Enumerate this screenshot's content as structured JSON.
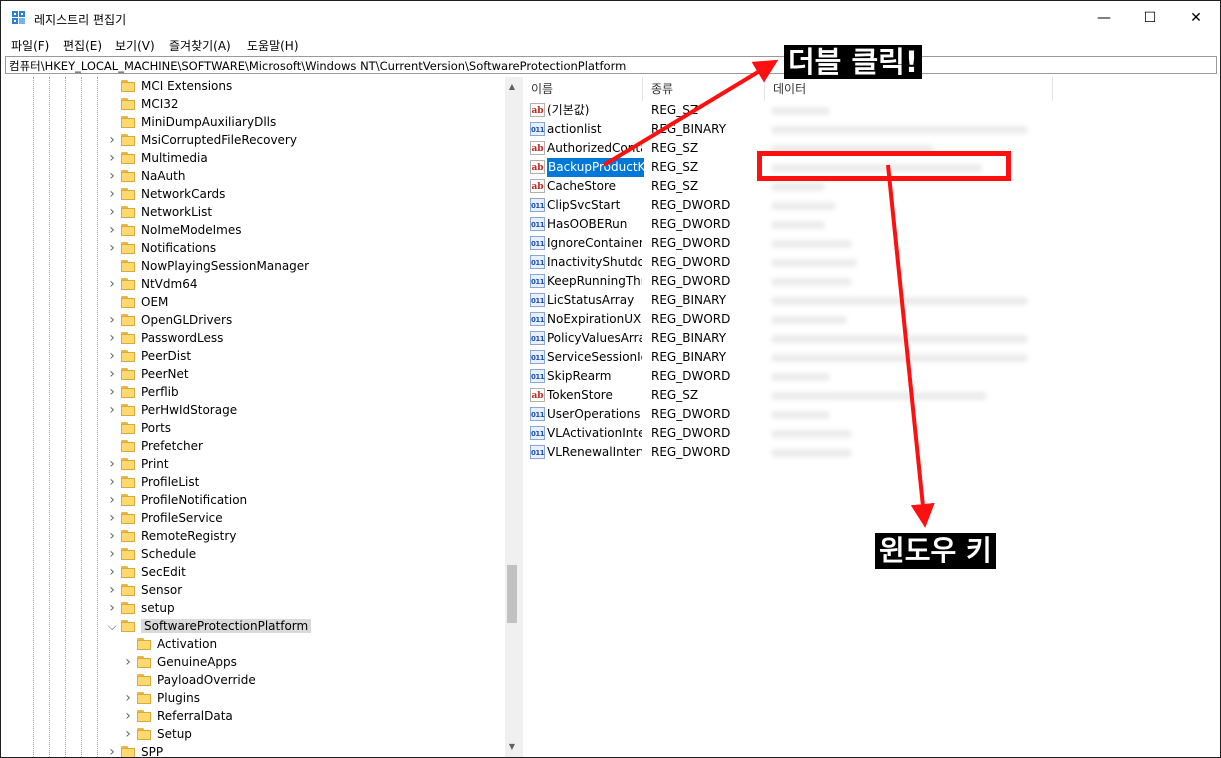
{
  "window": {
    "title": "레지스트리 편집기",
    "min_glyph": "—",
    "max_glyph": "☐",
    "close_glyph": "✕"
  },
  "menu": [
    "파일(F)",
    "편집(E)",
    "보기(V)",
    "즐겨찾기(A)",
    "도움말(H)"
  ],
  "address": "컴퓨터\\HKEY_LOCAL_MACHINE\\SOFTWARE\\Microsoft\\Windows NT\\CurrentVersion\\SoftwareProtectionPlatform",
  "tree": {
    "nodes": [
      {
        "label": "MCI Extensions",
        "expandable": false
      },
      {
        "label": "MCI32",
        "expandable": false
      },
      {
        "label": "MiniDumpAuxiliaryDlls",
        "expandable": false
      },
      {
        "label": "MsiCorruptedFileRecovery",
        "expandable": true
      },
      {
        "label": "Multimedia",
        "expandable": true
      },
      {
        "label": "NaAuth",
        "expandable": true
      },
      {
        "label": "NetworkCards",
        "expandable": true
      },
      {
        "label": "NetworkList",
        "expandable": true
      },
      {
        "label": "NoImeModeImes",
        "expandable": true
      },
      {
        "label": "Notifications",
        "expandable": true
      },
      {
        "label": "NowPlayingSessionManager",
        "expandable": false
      },
      {
        "label": "NtVdm64",
        "expandable": true
      },
      {
        "label": "OEM",
        "expandable": false
      },
      {
        "label": "OpenGLDrivers",
        "expandable": true
      },
      {
        "label": "PasswordLess",
        "expandable": true
      },
      {
        "label": "PeerDist",
        "expandable": true
      },
      {
        "label": "PeerNet",
        "expandable": true
      },
      {
        "label": "Perflib",
        "expandable": true
      },
      {
        "label": "PerHwIdStorage",
        "expandable": true
      },
      {
        "label": "Ports",
        "expandable": false
      },
      {
        "label": "Prefetcher",
        "expandable": false
      },
      {
        "label": "Print",
        "expandable": true
      },
      {
        "label": "ProfileList",
        "expandable": true
      },
      {
        "label": "ProfileNotification",
        "expandable": true
      },
      {
        "label": "ProfileService",
        "expandable": true
      },
      {
        "label": "RemoteRegistry",
        "expandable": true
      },
      {
        "label": "Schedule",
        "expandable": true
      },
      {
        "label": "SecEdit",
        "expandable": true
      },
      {
        "label": "Sensor",
        "expandable": true
      },
      {
        "label": "setup",
        "expandable": true
      },
      {
        "label": "SoftwareProtectionPlatform",
        "expandable": true,
        "expanded": true,
        "selected": true
      },
      {
        "label": "Activation",
        "expandable": false,
        "child": true
      },
      {
        "label": "GenuineApps",
        "expandable": true,
        "child": true
      },
      {
        "label": "PayloadOverride",
        "expandable": false,
        "child": true
      },
      {
        "label": "Plugins",
        "expandable": true,
        "child": true
      },
      {
        "label": "ReferralData",
        "expandable": true,
        "child": true
      },
      {
        "label": "Setup",
        "expandable": true,
        "child": true
      },
      {
        "label": "SPP",
        "expandable": true
      }
    ]
  },
  "values_pane": {
    "headers": {
      "name": "이름",
      "type": "종류",
      "data": "데이터"
    },
    "icon_glyphs": {
      "sz": "ab",
      "bin": "011"
    },
    "rows": [
      {
        "name": "(기본값)",
        "type": "REG_SZ",
        "icon": "sz",
        "data_fill": 0.22
      },
      {
        "name": "actionlist",
        "type": "REG_BINARY",
        "icon": "bin",
        "data_fill": 0.95
      },
      {
        "name": "AuthorizedContainers",
        "type": "REG_SZ",
        "icon": "sz",
        "data_fill": 0.6
      },
      {
        "name": "BackupProductKeyDefault",
        "type": "REG_SZ",
        "icon": "sz",
        "data_fill": 0.78,
        "selected": true
      },
      {
        "name": "CacheStore",
        "type": "REG_SZ",
        "icon": "sz",
        "data_fill": 0.2
      },
      {
        "name": "ClipSvcStart",
        "type": "REG_DWORD",
        "icon": "bin",
        "data_fill": 0.24
      },
      {
        "name": "HasOOBERun",
        "type": "REG_DWORD",
        "icon": "bin",
        "data_fill": 0.2
      },
      {
        "name": "IgnoreContainerOrigin",
        "type": "REG_DWORD",
        "icon": "bin",
        "data_fill": 0.3
      },
      {
        "name": "InactivityShutdownDelay",
        "type": "REG_DWORD",
        "icon": "bin",
        "data_fill": 0.32
      },
      {
        "name": "KeepRunningThresholdMins",
        "type": "REG_DWORD",
        "icon": "bin",
        "data_fill": 0.3
      },
      {
        "name": "LicStatusArray",
        "type": "REG_BINARY",
        "icon": "bin",
        "data_fill": 0.95
      },
      {
        "name": "NoExpirationUX",
        "type": "REG_DWORD",
        "icon": "bin",
        "data_fill": 0.28
      },
      {
        "name": "PolicyValuesArray",
        "type": "REG_BINARY",
        "icon": "bin",
        "data_fill": 0.95
      },
      {
        "name": "ServiceSessionId",
        "type": "REG_BINARY",
        "icon": "bin",
        "data_fill": 0.95
      },
      {
        "name": "SkipRearm",
        "type": "REG_DWORD",
        "icon": "bin",
        "data_fill": 0.22
      },
      {
        "name": "TokenStore",
        "type": "REG_SZ",
        "icon": "sz",
        "data_fill": 0.8
      },
      {
        "name": "UserOperations",
        "type": "REG_DWORD",
        "icon": "bin",
        "data_fill": 0.22
      },
      {
        "name": "VLActivationInterval",
        "type": "REG_DWORD",
        "icon": "bin",
        "data_fill": 0.3
      },
      {
        "name": "VLRenewalInterval",
        "type": "REG_DWORD",
        "icon": "bin",
        "data_fill": 0.3
      }
    ]
  },
  "annotations": {
    "double_click": "더블 클릭!",
    "windows_key": "윈도우 키",
    "color": "#ff1010"
  }
}
